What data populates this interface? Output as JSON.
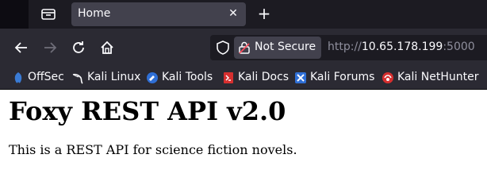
{
  "tabbar": {
    "tab_title": "Home",
    "close_symbol": "✕",
    "new_tab_symbol": "+"
  },
  "navbar": {
    "security_label": "Not Secure",
    "url_scheme": "http://",
    "url_host": "10.65.178.199",
    "url_port": ":5000"
  },
  "bookmarks": [
    {
      "label": "OffSec",
      "icon": "offsec-icon"
    },
    {
      "label": "Kali Linux",
      "icon": "kali-dragon-icon"
    },
    {
      "label": "Kali Tools",
      "icon": "kali-tools-icon"
    },
    {
      "label": "Kali Docs",
      "icon": "kali-docs-icon"
    },
    {
      "label": "Kali Forums",
      "icon": "kali-forums-icon"
    },
    {
      "label": "Kali NetHunter",
      "icon": "kali-nethunter-icon"
    }
  ],
  "page": {
    "heading": "Foxy REST API v2.0",
    "description": "This is a REST API for science fiction novels."
  },
  "colors": {
    "chrome_dark": "#1c1b22",
    "chrome_toolbar": "#2b2a33",
    "tab_active": "#42414d",
    "text_light": "#fbfbfe",
    "url_muted": "#8f8f9d"
  }
}
